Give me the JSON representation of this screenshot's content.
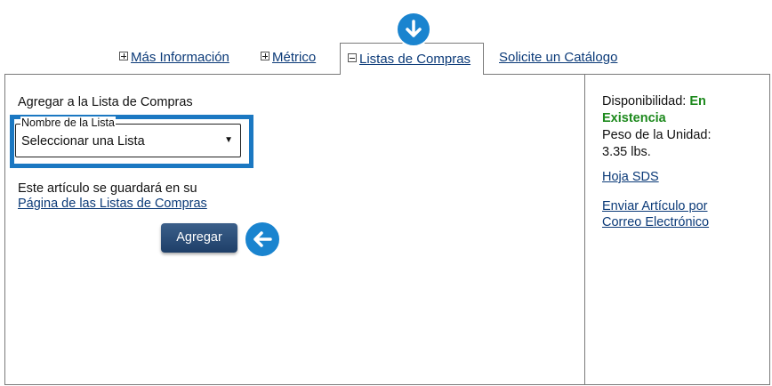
{
  "tabs": {
    "mas_info": "Más Información",
    "metrico": "Métrico",
    "listas": "Listas de Compras",
    "catalogo": "Solicite un Catálogo"
  },
  "shopping_list": {
    "heading": "Agregar a la Lista de Compras",
    "field_legend": "Nombre de la Lista",
    "select_value": "Seleccionar una Lista",
    "note": "Este artículo se guardará en su",
    "note_link": "Página de las Listas de Compras",
    "add_button": "Agregar"
  },
  "sidebar": {
    "availability_label": "Disponibilidad:",
    "availability_value": "En Existencia",
    "weight_label": "Peso de la Unidad:",
    "weight_value": "3.35 lbs.",
    "sds_link": "Hoja SDS",
    "email_link": "Enviar Artículo por Correo Electrónico"
  },
  "colors": {
    "accent": "#1a84cf",
    "link": "#0b3a78",
    "in_stock": "#1e8a1e",
    "button": "#1e3f68"
  }
}
